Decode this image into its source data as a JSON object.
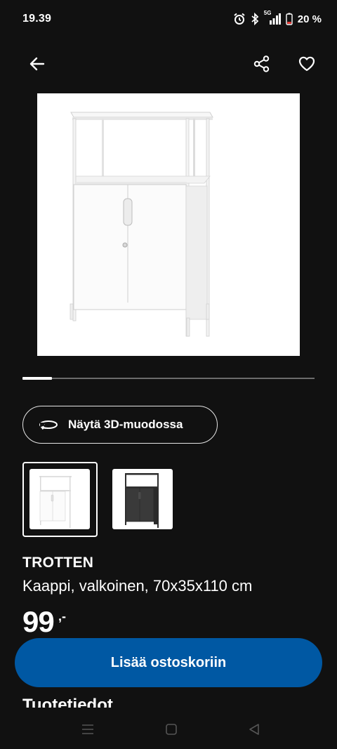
{
  "status_bar": {
    "time": "19.39",
    "network": "5G",
    "battery": "20 %",
    "icons": [
      "alarm-icon",
      "bluetooth-icon",
      "signal-icon",
      "battery-icon"
    ]
  },
  "toolbar": {
    "back_icon": "arrow-left-icon",
    "share_icon": "share-icon",
    "favorite_icon": "heart-outline-icon"
  },
  "gallery": {
    "image_alt": "white metal cabinet with shelf",
    "progress": 0.1
  },
  "view_3d": {
    "label": "Näytä 3D-muodossa",
    "icon": "rotate-3d-icon"
  },
  "variants": [
    {
      "color": "white",
      "selected": true
    },
    {
      "color": "black",
      "selected": false
    }
  ],
  "product": {
    "name": "TROTTEN",
    "description": "Kaappi, valkoinen, 70x35x110 cm",
    "price": "99",
    "price_suffix": ",-"
  },
  "cta": {
    "label": "Lisää ostoskoriin",
    "color": "#0058a3"
  },
  "section": {
    "title": "Tuotetiedot"
  },
  "nav": {
    "recents_icon": "recents-icon",
    "home_icon": "home-icon",
    "back_icon": "nav-back-icon"
  }
}
